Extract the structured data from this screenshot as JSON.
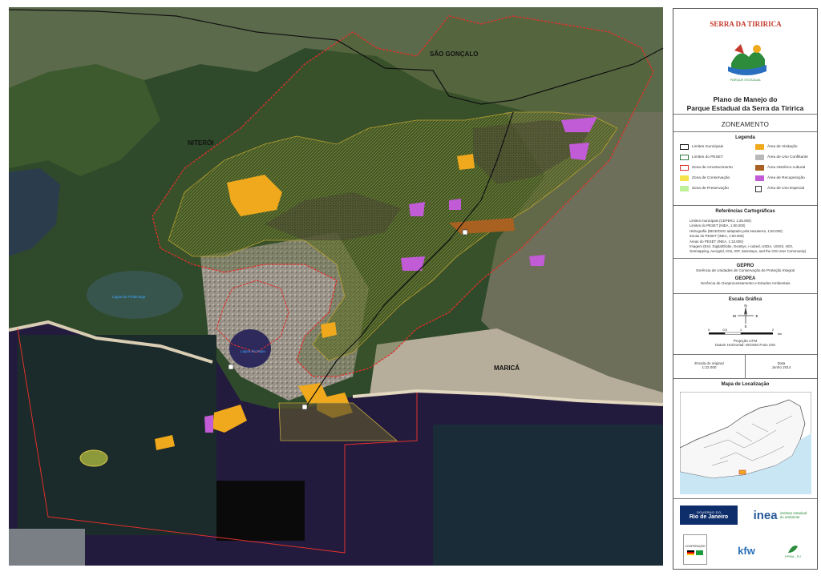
{
  "map": {
    "place_labels": [
      "SÃO GONÇALO",
      "NITERÓI",
      "MARICÁ"
    ],
    "water_labels": [
      "Lagoa de Piratininga",
      "Lagoa de Itaipu"
    ],
    "colors": {
      "park_boundary": "#e0312b",
      "municipal_boundary": "#111111",
      "visitation": "#f0a81c",
      "recovery": "#c15bd6",
      "historic_cultural": "#a86121",
      "conservation_zone": "#5e6b29"
    }
  },
  "panel": {
    "logo_text": "SERRA DA TIRIRICA",
    "logo_subtext": "PARQUE ESTADUAL",
    "title_line1": "Plano de Manejo do",
    "title_line2": "Parque Estadual da Serra da Tiririca",
    "section": "ZONEAMENTO",
    "legend_title": "Legenda",
    "legend_left": [
      {
        "label": "Limites municipais",
        "icon": "black-outline"
      },
      {
        "label": "Limites do PESET",
        "icon": "green-outline"
      },
      {
        "label": "Zona de Amortecimento",
        "icon": "red-outline"
      },
      {
        "label": "Zona de Conservação",
        "icon": "yellow-fill"
      },
      {
        "label": "Zona de Preservação",
        "icon": "light-green-fill"
      }
    ],
    "legend_right": [
      {
        "label": "Área de Visitação",
        "icon": "orange-fill"
      },
      {
        "label": "Área de Uso Conflitante",
        "icon": "grey-fill"
      },
      {
        "label": "Área Histórico-cultural",
        "icon": "brown-fill"
      },
      {
        "label": "Área de Recuperação",
        "icon": "purple-fill"
      },
      {
        "label": "Área de Uso Especial",
        "icon": "special-icon"
      }
    ],
    "ref_title": "Referências Cartográficas",
    "ref_lines": [
      "Limites municipais (CEPERJ, 1:25.000)",
      "Limites do PESET (INEA, 1:50.000)",
      "Hidrografia (IBGE/DSG adaptado pela Nexaterra, 1:50.000)",
      "Zonas do PESET (INEA, 1:50.000)",
      "Áreas do PESET (INEA, 1:10.000)",
      "Imagem (Esri, DigitalGlobe, GeoEye, i-cubed, USDA, USGS, AEX,",
      "Getmapping, Aerogrid, IGN, IGP, swisstopo, and the GIS User Community)"
    ],
    "org1": "GEPRO",
    "org1_desc": "Gerência de Unidades de Conservação de Proteção Integral",
    "org2": "GEOPEA",
    "org2_desc": "Gerência de Geoprocessamento e Estudos Ambientais",
    "scale_title": "Escala Gráfica",
    "scale_ticks": [
      "0",
      "0,5",
      "1",
      "2"
    ],
    "scale_unit": "km",
    "north": {
      "n": "N",
      "s": "S",
      "e": "E",
      "w": "W"
    },
    "projection_line1": "Projeção UTM",
    "projection_line2": "Datum Horizontal: WGS84   Fuso 23S",
    "scale_label": "Escala do original",
    "scale_value": "1:22.000",
    "date_label": "Data",
    "date_value": "Junho 2014",
    "location_title": "Mapa de Localização",
    "logo_gov_top": "GOVERNO DO",
    "logo_gov_bottom": "Rio de Janeiro",
    "logo_inea": "inea",
    "logo_inea_sub1": "instituto estadual",
    "logo_inea_sub2": "do ambiente",
    "logo_coop": "COOPERAÇÃO",
    "logo_kfw": "kfw",
    "logo_pprw": "PPMA - RJ"
  }
}
